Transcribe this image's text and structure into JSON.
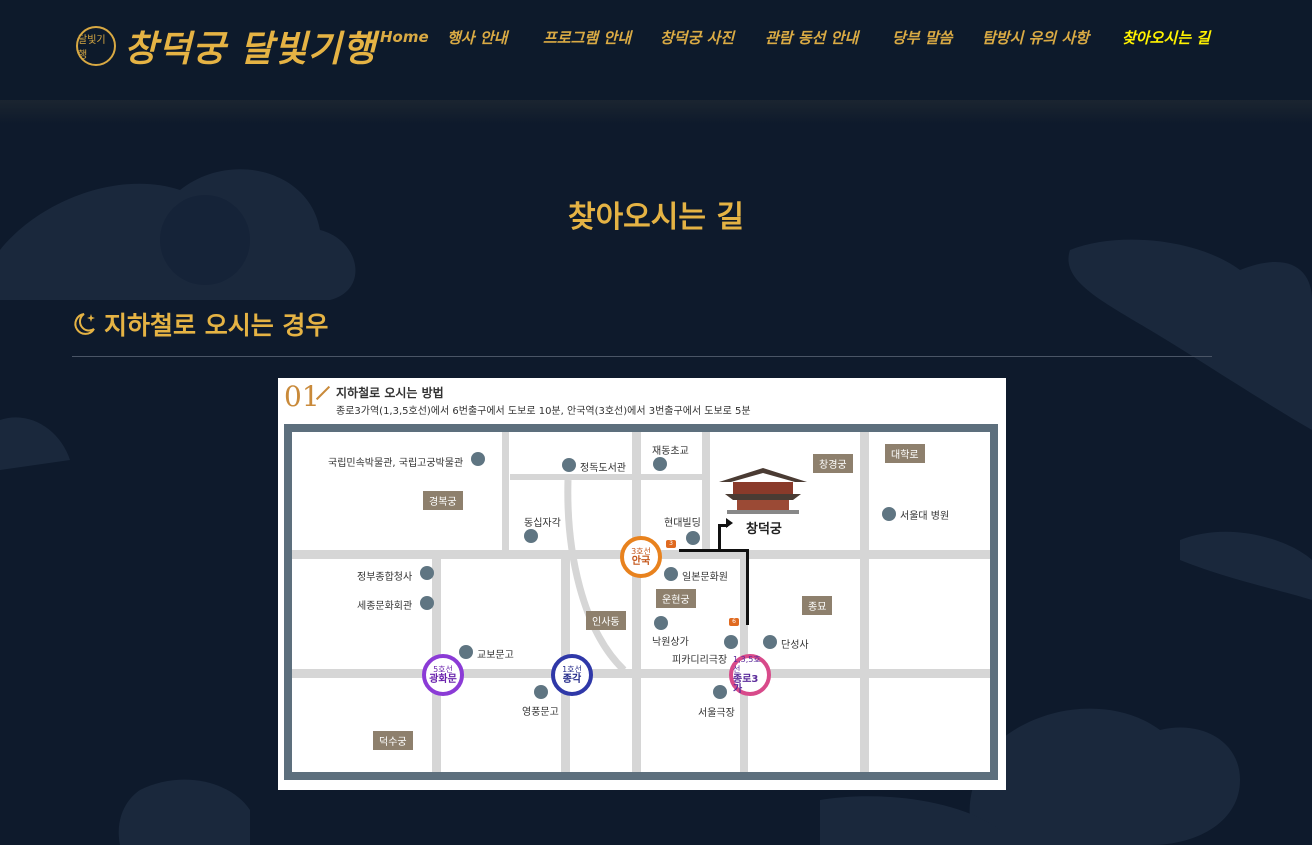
{
  "header": {
    "logo_text": "창덕궁 달빛기행",
    "logo_emblem": "달빛기행",
    "nav": [
      {
        "label": "Home",
        "active": false
      },
      {
        "label": "행사 안내",
        "active": false
      },
      {
        "label": "프로그램 안내",
        "active": false
      },
      {
        "label": "창덕궁 사진",
        "active": false
      },
      {
        "label": "관람 동선 안내",
        "active": false
      },
      {
        "label": "당부 말씀",
        "active": false
      },
      {
        "label": "탐방시 유의 사항",
        "active": false
      },
      {
        "label": "찾아오시는 길",
        "active": true
      }
    ]
  },
  "page_title": "찾아오시는 길",
  "section": {
    "icon": "moon-star-icon",
    "title": "지하철로 오시는 경우"
  },
  "map": {
    "number": "01",
    "title": "지하철로 오시는 방법",
    "subtitle": "종로3가역(1,3,5호선)에서 6번출구에서 도보로 10분, 안국역(3호선)에서 3번출구에서 도보로 5분",
    "landmark": "창덕궁",
    "places": {
      "museum": "국립민속박물관, 국립고궁박물관",
      "jeongdok": "정독도서관",
      "jaedong": "재동초교",
      "dongsipja": "동십자각",
      "hyundai": "현대빌딩",
      "seoul_hospital": "서울대 병원",
      "jeongbu": "정부종합청사",
      "sejong": "세종문화회관",
      "ilbon": "일본문화원",
      "nagwon": "낙원상가",
      "piccadilly": "피카디리극장",
      "danseongsa": "단성사",
      "kyobo": "교보문고",
      "youngpung": "영풍문고",
      "seoul_theater": "서울극장"
    },
    "tags": {
      "changgyeong": "창경궁",
      "daehakro": "대학로",
      "gyeongbok": "경복궁",
      "unhyeon": "운현궁",
      "insadong": "인사동",
      "jongmyo": "종묘",
      "deoksu": "덕수궁"
    },
    "stations": [
      {
        "line": "3호선",
        "name": "안국",
        "color": "#e8821e"
      },
      {
        "line": "5호선",
        "name": "광화문",
        "color": "#8b3bd6"
      },
      {
        "line": "1호선",
        "name": "종각",
        "color": "#2f38a8"
      },
      {
        "line": "1,3,5호선",
        "name": "종로3가",
        "color": "#d84a8a"
      }
    ],
    "exits": [
      "3",
      "6"
    ]
  }
}
